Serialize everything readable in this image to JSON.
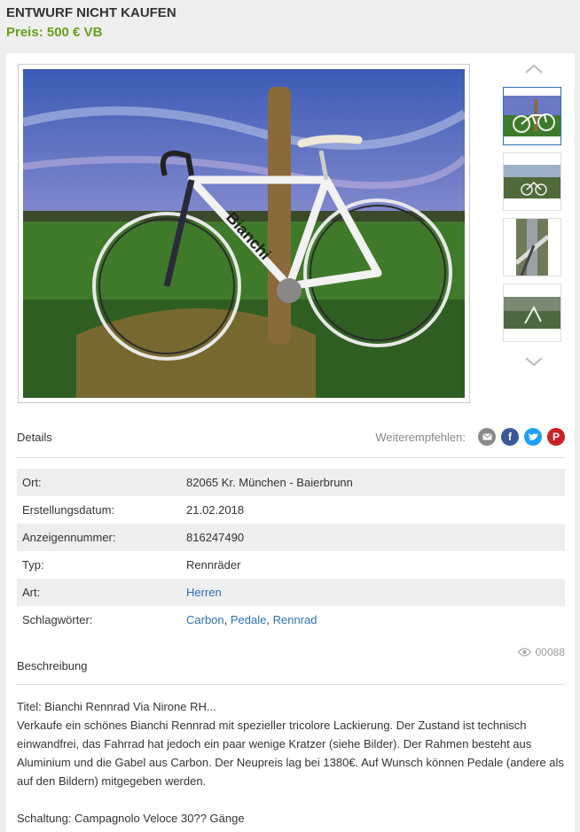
{
  "header": {
    "title": "ENTWURF NICHT KAUFEN",
    "price": "Preis: 500 € VB"
  },
  "gallery": {
    "main_image": "bianchi-road-bike-photo",
    "thumbnails": [
      "bike-photo-1",
      "bike-photo-2",
      "bike-photo-3",
      "bike-photo-4"
    ],
    "active_index": 0,
    "up_icon": "chevron-up-icon",
    "down_icon": "chevron-down-icon"
  },
  "details_section": {
    "heading": "Details",
    "share_label": "Weiterempfehlen:",
    "share_icons": [
      "email-icon",
      "facebook-icon",
      "twitter-icon",
      "pinterest-icon"
    ],
    "rows": [
      {
        "label": "Ort:",
        "value": "82065 Kr. München - Baierbrunn"
      },
      {
        "label": "Erstellungsdatum:",
        "value": "21.02.2018"
      },
      {
        "label": "Anzeigennummer:",
        "value": "816247490"
      },
      {
        "label": "Typ:",
        "value": "Rennräder"
      },
      {
        "label": "Art:",
        "value": "Herren"
      },
      {
        "label": "Schlagwörter:",
        "tags": [
          "Carbon",
          "Pedale",
          "Rennrad"
        ],
        "separator": ", "
      }
    ]
  },
  "views": {
    "icon": "eye-icon",
    "count": "00088"
  },
  "description": {
    "heading": "Beschreibung",
    "title_line": "Titel: Bianchi Rennrad Via Nirone RH...",
    "body": "Verkaufe ein schönes Bianchi Rennrad mit spezieller tricolore Lackierung. Der Zustand ist technisch einwandfrei, das Fahrrad hat jedoch ein paar wenige Kratzer (siehe Bilder). Der Rahmen besteht aus Aluminium und die Gabel aus Carbon. Der Neupreis lag bei 1380€. Auf Wunsch können Pedale (andere als auf den Bildern) mitgegeben werden.",
    "gear_line": "Schaltung: Campagnolo Veloce 30?? Gänge"
  },
  "colors": {
    "price_green": "#6a9e1f",
    "link_blue": "#2b6fb6",
    "email_gray": "#8a8a8a",
    "facebook_blue": "#3b5998",
    "twitter_blue": "#1da1f2",
    "pinterest_red": "#cb2027"
  }
}
